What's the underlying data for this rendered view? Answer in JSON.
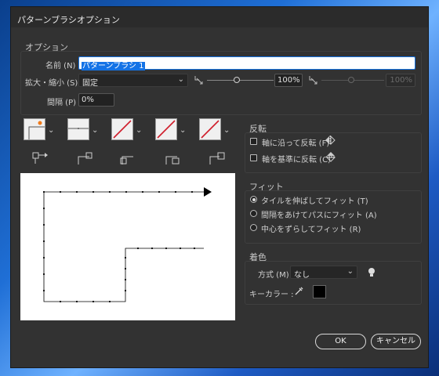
{
  "window": {
    "title": "パターンブラシオプション"
  },
  "options": {
    "group_label": "オプション",
    "name_label": "名前 (N) :",
    "name_value": "パターンブラシ 1",
    "scale_label": "拡大・縮小 (S) :",
    "scale_mode": "固定",
    "scale_value": "100%",
    "scale_value2": "100%",
    "spacing_label": "間隔 (P) :",
    "spacing_value": "0%"
  },
  "tiles": [
    {
      "name": "side-tile"
    },
    {
      "name": "outer-corner-tile"
    },
    {
      "name": "inner-corner-tile"
    },
    {
      "name": "start-tile"
    },
    {
      "name": "end-tile"
    }
  ],
  "flip": {
    "group_label": "反転",
    "along_label": "軸に沿って反転 (F)",
    "along_checked": false,
    "across_label": "軸を基準に反転 (C)",
    "across_checked": false
  },
  "fit": {
    "group_label": "フィット",
    "options": [
      {
        "label": "タイルを伸ばしてフィット (T)",
        "selected": true
      },
      {
        "label": "間隔をあけてパスにフィット (A)",
        "selected": false
      },
      {
        "label": "中心をずらしてフィット (R)",
        "selected": false
      }
    ]
  },
  "colorization": {
    "group_label": "着色",
    "method_label": "方式 (M) :",
    "method_value": "なし",
    "key_color_label": "キーカラー :",
    "key_color": "#000000"
  },
  "buttons": {
    "ok": "OK",
    "cancel": "キャンセル"
  },
  "colors": {
    "dialog_bg": "#323232",
    "accent": "#1473e6",
    "tile_red": "#d01c2a",
    "corner_orange": "#f07a1a"
  }
}
